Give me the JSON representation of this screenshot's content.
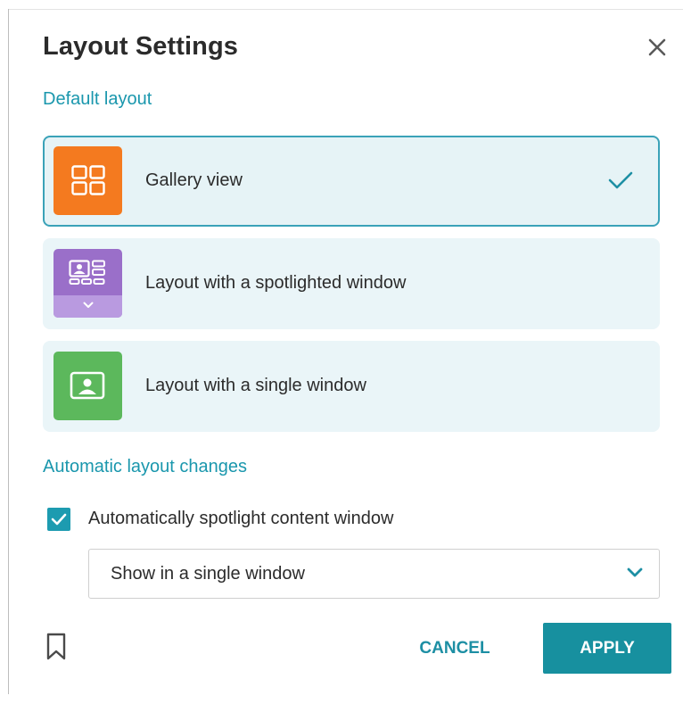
{
  "dialog": {
    "title": "Layout Settings",
    "close_icon": "close-icon"
  },
  "default_layout": {
    "heading": "Default layout",
    "options": [
      {
        "label": "Gallery view",
        "icon": "gallery-grid-icon",
        "color": "#f47a1f",
        "selected": true
      },
      {
        "label": "Layout with a spotlighted window",
        "icon": "spotlight-layout-icon",
        "color": "#9a6fc9",
        "selected": false
      },
      {
        "label": "Layout with a single window",
        "icon": "single-window-icon",
        "color": "#5cb85c",
        "selected": false
      }
    ]
  },
  "automatic_layout": {
    "heading": "Automatic layout changes",
    "checkbox": {
      "label": "Automatically spotlight content window",
      "checked": true
    },
    "select": {
      "value": "Show in a single window"
    }
  },
  "footer": {
    "bookmark_icon": "bookmark-icon",
    "cancel_label": "CANCEL",
    "apply_label": "APPLY"
  },
  "colors": {
    "accent": "#1a97ad",
    "apply_button": "#17909f",
    "card_background": "#eaf5f8"
  }
}
